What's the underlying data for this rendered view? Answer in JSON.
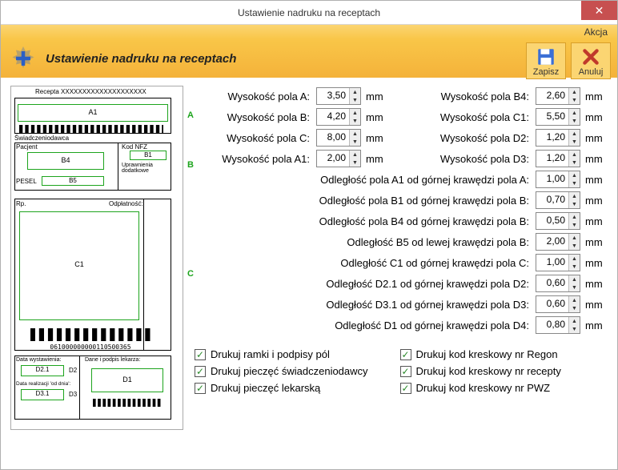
{
  "titlebar": {
    "title": "Ustawienie nadruku na receptach"
  },
  "actionlabel": "Akcja",
  "header": {
    "title": "Ustawienie nadruku na receptach",
    "save": "Zapisz",
    "cancel": "Anuluj"
  },
  "preview": {
    "recepta": "Recepta XXXXXXXXXXXXXXXXXXXX",
    "grp_swiadcz": "Świadczeniodawca",
    "pacjent": "Pacjent",
    "kod_nfz": "Kod NFZ",
    "upraw": "Uprawnienia\ndodatkowe",
    "pesel": "PESEL",
    "rp": "Rp.",
    "odplatnosc": "Odpłatność:",
    "barcode_num": "061000000000110500365",
    "data_wyst": "Data wystawienia:",
    "data_real": "Data realizacji 'od dnia':",
    "dane_lek": "Dane i podpis lekarza:",
    "A1": "A1",
    "B1": "B1",
    "B4": "B4",
    "B5": "B5",
    "C1": "C1",
    "D1": "D1",
    "D2_1": "D2.1",
    "D3_1": "D3.1",
    "A": "A",
    "B": "B",
    "C": "C",
    "D2": "D2",
    "D3": "D3"
  },
  "fields": {
    "wysA": {
      "label": "Wysokość pola A:",
      "value": "3,50"
    },
    "wysB": {
      "label": "Wysokość pola B:",
      "value": "4,20"
    },
    "wysC": {
      "label": "Wysokość pola C:",
      "value": "8,00"
    },
    "wysA1": {
      "label": "Wysokość pola A1:",
      "value": "2,00"
    },
    "wysB4": {
      "label": "Wysokość pola B4:",
      "value": "2,60"
    },
    "wysC1": {
      "label": "Wysokość pola C1:",
      "value": "5,50"
    },
    "wysD2": {
      "label": "Wysokość pola D2:",
      "value": "1,20"
    },
    "wysD3": {
      "label": "Wysokość pola D3:",
      "value": "1,20"
    },
    "odA1": {
      "label": "Odległość pola A1 od górnej krawędzi pola A:",
      "value": "1,00"
    },
    "odB1": {
      "label": "Odległość pola B1 od górnej krawędzi pola B:",
      "value": "0,70"
    },
    "odB4": {
      "label": "Odległość pola B4 od górnej krawędzi pola B:",
      "value": "0,50"
    },
    "odB5": {
      "label": "Odległość B5 od lewej krawędzi pola B:",
      "value": "2,00"
    },
    "odC1": {
      "label": "Odległość C1 od górnej krawędzi pola C:",
      "value": "1,00"
    },
    "odD21": {
      "label": "Odległość D2.1 od górnej krawędzi pola D2:",
      "value": "0,60"
    },
    "odD31": {
      "label": "Odległość D3.1 od górnej krawędzi pola D3:",
      "value": "0,60"
    },
    "odD1": {
      "label": "Odległość D1 od górnej krawędzi pola D4:",
      "value": "0,80"
    }
  },
  "unit": "mm",
  "checks": {
    "c1": "Drukuj ramki i podpisy pól",
    "c2": "Drukuj pieczęć świadczeniodawcy",
    "c3": "Drukuj pieczęć lekarską",
    "c4": "Drukuj kod kreskowy nr Regon",
    "c5": "Drukuj kod kreskowy nr recepty",
    "c6": "Drukuj kod kreskowy nr PWZ"
  }
}
